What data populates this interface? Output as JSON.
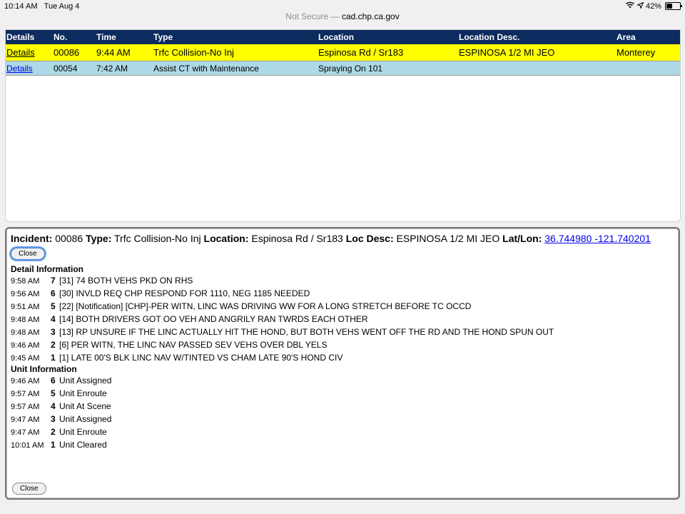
{
  "status": {
    "time": "10:14 AM",
    "date": "Tue Aug 4",
    "battery": "42%",
    "battery_level": 0.42
  },
  "url": {
    "not_secure": "Not Secure —",
    "domain": "cad.chp.ca.gov"
  },
  "table": {
    "headers": [
      "Details",
      "No.",
      "Time",
      "Type",
      "Location",
      "Location Desc.",
      "Area"
    ],
    "rows": [
      {
        "details": "Details",
        "no": "00086",
        "time": "9:44 AM",
        "type": "Trfc Collision-No Inj",
        "location": "Espinosa Rd / Sr183",
        "desc": "ESPINOSA 1/2 MI JEO",
        "area": "Monterey"
      },
      {
        "details": "Details",
        "no": "00054",
        "time": "7:42 AM",
        "type": "Assist CT with Maintenance",
        "location": "Spraying On 101",
        "desc": "",
        "area": ""
      }
    ]
  },
  "incident": {
    "incident_label": "Incident:",
    "incident_no": "00086",
    "type_label": "Type:",
    "type": "Trfc Collision-No Inj",
    "location_label": "Location:",
    "location": "Espinosa Rd / Sr183",
    "locdesc_label": "Loc Desc:",
    "locdesc": "ESPINOSA 1/2 MI JEO",
    "latlon_label": "Lat/Lon:",
    "latlon": "36.744980 -121.740201"
  },
  "close_label": "Close",
  "detail_info": {
    "title": "Detail Information",
    "rows": [
      {
        "time": "9:58 AM",
        "num": "7",
        "text": "[31] 74 BOTH VEHS PKD ON RHS"
      },
      {
        "time": "9:56 AM",
        "num": "6",
        "text": "[30] INVLD REQ CHP RESPOND FOR 1110, NEG 1185 NEEDED"
      },
      {
        "time": "9:51 AM",
        "num": "5",
        "text": "[22] [Notification] [CHP]-PER WITN, LINC WAS DRIVING WW FOR A LONG STRETCH BEFORE TC OCCD"
      },
      {
        "time": "9:48 AM",
        "num": "4",
        "text": "[14] BOTH DRIVERS GOT OO VEH AND ANGRILY RAN TWRDS EACH OTHER"
      },
      {
        "time": "9:48 AM",
        "num": "3",
        "text": "[13] RP UNSURE IF THE LINC ACTUALLY HIT THE HOND, BUT BOTH VEHS WENT OFF THE RD AND THE HOND SPUN OUT"
      },
      {
        "time": "9:46 AM",
        "num": "2",
        "text": "[6] PER WITN, THE LINC NAV PASSED SEV VEHS OVER DBL YELS"
      },
      {
        "time": "9:45 AM",
        "num": "1",
        "text": "[1] LATE 00'S BLK LINC NAV W/TINTED VS CHAM LATE 90'S HOND CIV"
      }
    ]
  },
  "unit_info": {
    "title": "Unit Information",
    "rows": [
      {
        "time": "9:46 AM",
        "num": "6",
        "text": "Unit Assigned"
      },
      {
        "time": "9:57 AM",
        "num": "5",
        "text": "Unit Enroute"
      },
      {
        "time": "9:57 AM",
        "num": "4",
        "text": "Unit At Scene"
      },
      {
        "time": "9:47 AM",
        "num": "3",
        "text": "Unit Assigned"
      },
      {
        "time": "9:47 AM",
        "num": "2",
        "text": "Unit Enroute"
      },
      {
        "time": "10:01 AM",
        "num": "1",
        "text": "Unit Cleared"
      }
    ]
  }
}
